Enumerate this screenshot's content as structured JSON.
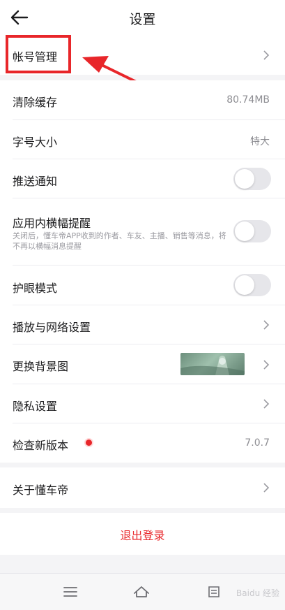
{
  "header": {
    "title": "设置"
  },
  "rows": {
    "account": {
      "label": "帐号管理"
    },
    "clear_cache": {
      "label": "清除缓存",
      "value": "80.74MB"
    },
    "font_size": {
      "label": "字号大小",
      "value": "特大"
    },
    "push": {
      "label": "推送通知",
      "enabled": false
    },
    "banner": {
      "label": "应用内横幅提醒",
      "desc": "关闭后，懂车帝APP收到的作者、车友、主播、销售等消息，将不再以横幅消息提醒",
      "enabled": false
    },
    "eye_mode": {
      "label": "护眼模式",
      "enabled": false
    },
    "playback": {
      "label": "播放与网络设置"
    },
    "background": {
      "label": "更换背景图"
    },
    "privacy": {
      "label": "隐私设置"
    },
    "update": {
      "label": "检查新版本",
      "value": "7.0.7"
    },
    "about": {
      "label": "关于懂车帝"
    }
  },
  "logout": {
    "label": "退出登录"
  },
  "navbar": {
    "icons": [
      "menu-icon",
      "home-icon",
      "back-icon"
    ]
  },
  "watermark": {
    "text": "Baidu 经验"
  },
  "colors": {
    "accent_red": "#e8262a",
    "text": "#1c1c1e",
    "muted": "#8e8e93"
  }
}
